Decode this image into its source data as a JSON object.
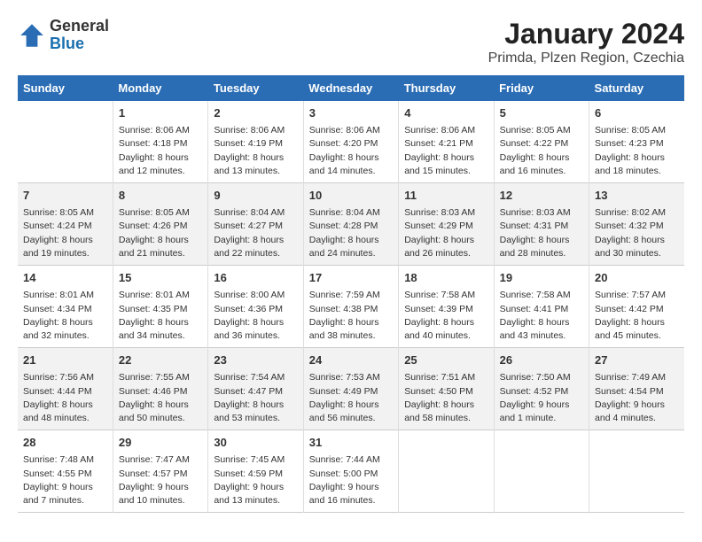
{
  "header": {
    "logo_line1": "General",
    "logo_line2": "Blue",
    "title": "January 2024",
    "subtitle": "Primda, Plzen Region, Czechia"
  },
  "days_of_week": [
    "Sunday",
    "Monday",
    "Tuesday",
    "Wednesday",
    "Thursday",
    "Friday",
    "Saturday"
  ],
  "weeks": [
    [
      {
        "day": "",
        "content": ""
      },
      {
        "day": "1",
        "content": "Sunrise: 8:06 AM\nSunset: 4:18 PM\nDaylight: 8 hours\nand 12 minutes."
      },
      {
        "day": "2",
        "content": "Sunrise: 8:06 AM\nSunset: 4:19 PM\nDaylight: 8 hours\nand 13 minutes."
      },
      {
        "day": "3",
        "content": "Sunrise: 8:06 AM\nSunset: 4:20 PM\nDaylight: 8 hours\nand 14 minutes."
      },
      {
        "day": "4",
        "content": "Sunrise: 8:06 AM\nSunset: 4:21 PM\nDaylight: 8 hours\nand 15 minutes."
      },
      {
        "day": "5",
        "content": "Sunrise: 8:05 AM\nSunset: 4:22 PM\nDaylight: 8 hours\nand 16 minutes."
      },
      {
        "day": "6",
        "content": "Sunrise: 8:05 AM\nSunset: 4:23 PM\nDaylight: 8 hours\nand 18 minutes."
      }
    ],
    [
      {
        "day": "7",
        "content": "Sunrise: 8:05 AM\nSunset: 4:24 PM\nDaylight: 8 hours\nand 19 minutes."
      },
      {
        "day": "8",
        "content": "Sunrise: 8:05 AM\nSunset: 4:26 PM\nDaylight: 8 hours\nand 21 minutes."
      },
      {
        "day": "9",
        "content": "Sunrise: 8:04 AM\nSunset: 4:27 PM\nDaylight: 8 hours\nand 22 minutes."
      },
      {
        "day": "10",
        "content": "Sunrise: 8:04 AM\nSunset: 4:28 PM\nDaylight: 8 hours\nand 24 minutes."
      },
      {
        "day": "11",
        "content": "Sunrise: 8:03 AM\nSunset: 4:29 PM\nDaylight: 8 hours\nand 26 minutes."
      },
      {
        "day": "12",
        "content": "Sunrise: 8:03 AM\nSunset: 4:31 PM\nDaylight: 8 hours\nand 28 minutes."
      },
      {
        "day": "13",
        "content": "Sunrise: 8:02 AM\nSunset: 4:32 PM\nDaylight: 8 hours\nand 30 minutes."
      }
    ],
    [
      {
        "day": "14",
        "content": "Sunrise: 8:01 AM\nSunset: 4:34 PM\nDaylight: 8 hours\nand 32 minutes."
      },
      {
        "day": "15",
        "content": "Sunrise: 8:01 AM\nSunset: 4:35 PM\nDaylight: 8 hours\nand 34 minutes."
      },
      {
        "day": "16",
        "content": "Sunrise: 8:00 AM\nSunset: 4:36 PM\nDaylight: 8 hours\nand 36 minutes."
      },
      {
        "day": "17",
        "content": "Sunrise: 7:59 AM\nSunset: 4:38 PM\nDaylight: 8 hours\nand 38 minutes."
      },
      {
        "day": "18",
        "content": "Sunrise: 7:58 AM\nSunset: 4:39 PM\nDaylight: 8 hours\nand 40 minutes."
      },
      {
        "day": "19",
        "content": "Sunrise: 7:58 AM\nSunset: 4:41 PM\nDaylight: 8 hours\nand 43 minutes."
      },
      {
        "day": "20",
        "content": "Sunrise: 7:57 AM\nSunset: 4:42 PM\nDaylight: 8 hours\nand 45 minutes."
      }
    ],
    [
      {
        "day": "21",
        "content": "Sunrise: 7:56 AM\nSunset: 4:44 PM\nDaylight: 8 hours\nand 48 minutes."
      },
      {
        "day": "22",
        "content": "Sunrise: 7:55 AM\nSunset: 4:46 PM\nDaylight: 8 hours\nand 50 minutes."
      },
      {
        "day": "23",
        "content": "Sunrise: 7:54 AM\nSunset: 4:47 PM\nDaylight: 8 hours\nand 53 minutes."
      },
      {
        "day": "24",
        "content": "Sunrise: 7:53 AM\nSunset: 4:49 PM\nDaylight: 8 hours\nand 56 minutes."
      },
      {
        "day": "25",
        "content": "Sunrise: 7:51 AM\nSunset: 4:50 PM\nDaylight: 8 hours\nand 58 minutes."
      },
      {
        "day": "26",
        "content": "Sunrise: 7:50 AM\nSunset: 4:52 PM\nDaylight: 9 hours\nand 1 minute."
      },
      {
        "day": "27",
        "content": "Sunrise: 7:49 AM\nSunset: 4:54 PM\nDaylight: 9 hours\nand 4 minutes."
      }
    ],
    [
      {
        "day": "28",
        "content": "Sunrise: 7:48 AM\nSunset: 4:55 PM\nDaylight: 9 hours\nand 7 minutes."
      },
      {
        "day": "29",
        "content": "Sunrise: 7:47 AM\nSunset: 4:57 PM\nDaylight: 9 hours\nand 10 minutes."
      },
      {
        "day": "30",
        "content": "Sunrise: 7:45 AM\nSunset: 4:59 PM\nDaylight: 9 hours\nand 13 minutes."
      },
      {
        "day": "31",
        "content": "Sunrise: 7:44 AM\nSunset: 5:00 PM\nDaylight: 9 hours\nand 16 minutes."
      },
      {
        "day": "",
        "content": ""
      },
      {
        "day": "",
        "content": ""
      },
      {
        "day": "",
        "content": ""
      }
    ]
  ]
}
